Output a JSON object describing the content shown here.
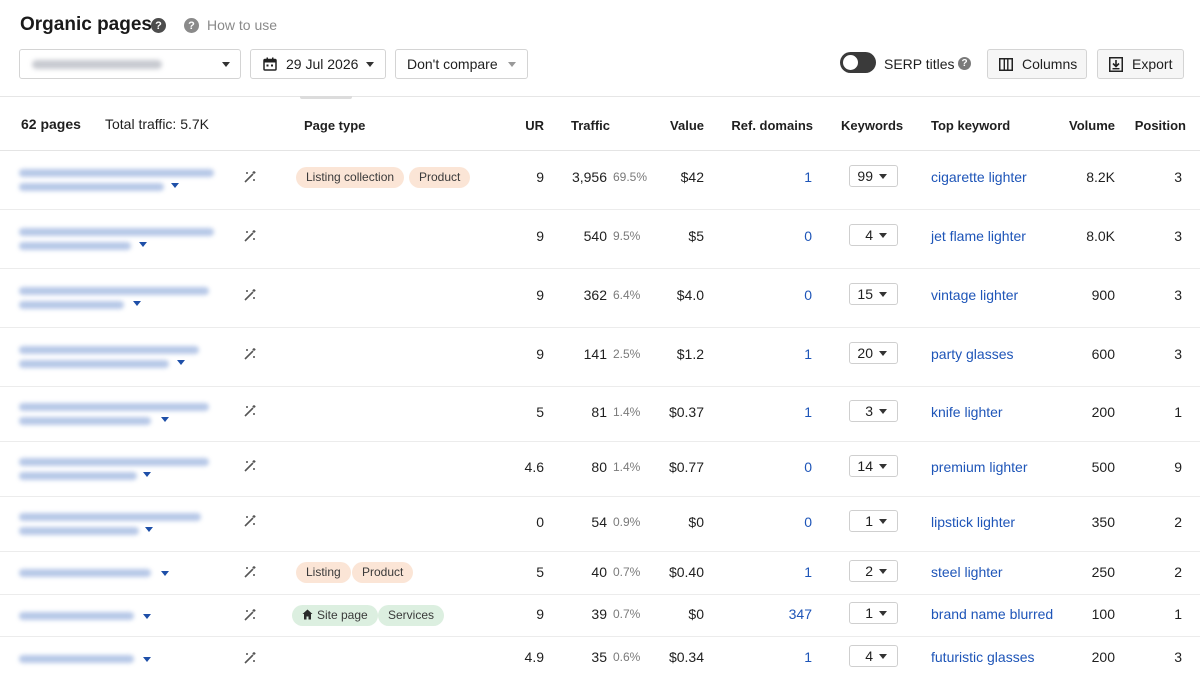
{
  "header": {
    "title": "Organic pages",
    "title_help_icon": "?",
    "how_to_use": "How to use",
    "date": "29 Jul 2026",
    "compare": "Don't compare",
    "serp_titles": "SERP titles",
    "serp_help_icon": "?",
    "columns_label": "Columns",
    "export_label": "Export"
  },
  "summary": {
    "pages": "62 pages",
    "total_traffic": "Total traffic: 5.7K"
  },
  "columns": {
    "page_type": "Page type",
    "ur": "UR",
    "traffic": "Traffic",
    "value": "Value",
    "ref_domains": "Ref. domains",
    "keywords": "Keywords",
    "top_keyword": "Top keyword",
    "volume": "Volume",
    "position": "Position"
  },
  "colors": {
    "link_blue": "#1e55b8",
    "tag_orange": "#fbe5d6",
    "tag_green": "#dcefe0"
  },
  "rows": [
    {
      "tags": [
        "Listing collection",
        "Product"
      ],
      "ur": "9",
      "traffic": "3,956",
      "pct": "69.5%",
      "value": "$42",
      "ref_domains": "1",
      "keywords": "99",
      "top_keyword": "cigarette lighter",
      "volume": "8.2K",
      "position": "3"
    },
    {
      "tags": [],
      "ur": "9",
      "traffic": "540",
      "pct": "9.5%",
      "value": "$5",
      "ref_domains": "0",
      "keywords": "4",
      "top_keyword": "jet flame lighter",
      "volume": "8.0K",
      "position": "3"
    },
    {
      "tags": [],
      "ur": "9",
      "traffic": "362",
      "pct": "6.4%",
      "value": "$4.0",
      "ref_domains": "0",
      "keywords": "15",
      "top_keyword": "vintage lighter",
      "volume": "900",
      "position": "3"
    },
    {
      "tags": [],
      "ur": "9",
      "traffic": "141",
      "pct": "2.5%",
      "value": "$1.2",
      "ref_domains": "1",
      "keywords": "20",
      "top_keyword": "party glasses",
      "volume": "600",
      "position": "3"
    },
    {
      "tags": [],
      "ur": "5",
      "traffic": "81",
      "pct": "1.4%",
      "value": "$0.37",
      "ref_domains": "1",
      "keywords": "3",
      "top_keyword": "knife lighter",
      "volume": "200",
      "position": "1"
    },
    {
      "tags": [],
      "ur": "4.6",
      "traffic": "80",
      "pct": "1.4%",
      "value": "$0.77",
      "ref_domains": "0",
      "keywords": "14",
      "top_keyword": "premium lighter",
      "volume": "500",
      "position": "9"
    },
    {
      "tags": [],
      "ur": "0",
      "traffic": "54",
      "pct": "0.9%",
      "value": "$0",
      "ref_domains": "0",
      "keywords": "1",
      "top_keyword": "lipstick lighter",
      "volume": "350",
      "position": "2"
    },
    {
      "tags": [
        "Listing",
        "Product"
      ],
      "ur": "5",
      "traffic": "40",
      "pct": "0.7%",
      "value": "$0.40",
      "ref_domains": "1",
      "keywords": "2",
      "top_keyword": "steel lighter",
      "volume": "250",
      "position": "2"
    },
    {
      "tags": [
        "Site page",
        "Services"
      ],
      "ur": "9",
      "traffic": "39",
      "pct": "0.7%",
      "value": "$0",
      "ref_domains": "347",
      "keywords": "1",
      "top_keyword": "brand name blurred",
      "volume": "100",
      "position": "1"
    },
    {
      "tags": [],
      "ur": "4.9",
      "traffic": "35",
      "pct": "0.6%",
      "value": "$0.34",
      "ref_domains": "1",
      "keywords": "4",
      "top_keyword": "futuristic glasses",
      "volume": "200",
      "position": "3"
    }
  ]
}
